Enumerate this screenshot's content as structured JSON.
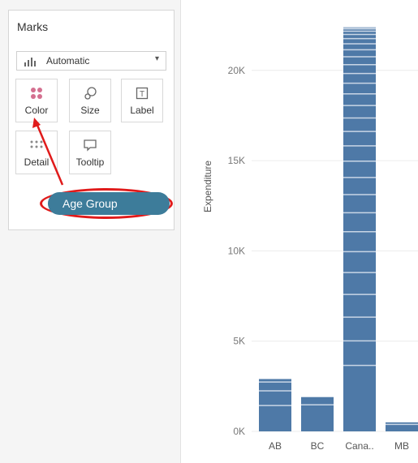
{
  "marks_card": {
    "title": "Marks",
    "mark_type": "Automatic",
    "buttons": {
      "color": "Color",
      "size": "Size",
      "label": "Label",
      "detail": "Detail",
      "tooltip": "Tooltip"
    },
    "pill": "Age Group"
  },
  "chart_data": {
    "type": "bar",
    "ylabel": "Expenditure",
    "ylim": [
      0,
      23000
    ],
    "y_ticks": [
      "0K",
      "5K",
      "10K",
      "15K",
      "20K"
    ],
    "categories": [
      "AB",
      "BC",
      "Cana..",
      "MB"
    ],
    "values": [
      2900,
      1900,
      22400,
      500
    ],
    "stacked_by": "Age Group",
    "bar_color": "#4e79a7",
    "segment_divider_color": "#c9d6e6"
  },
  "colors": {
    "accent_pill": "#3d7c9a",
    "highlight": "#e01b1b"
  }
}
